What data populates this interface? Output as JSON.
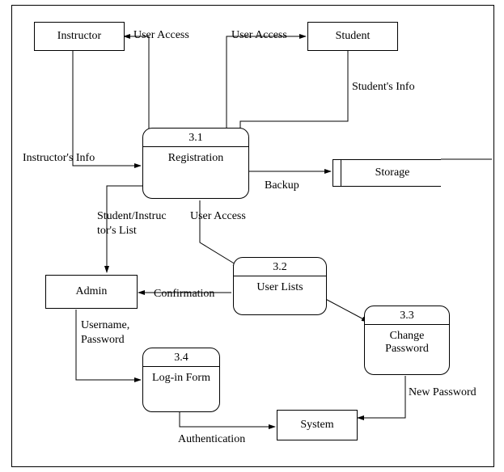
{
  "entities": {
    "instructor": "Instructor",
    "student": "Student",
    "admin": "Admin",
    "system": "System"
  },
  "processes": {
    "p31": {
      "num": "3.1",
      "name": "Registration"
    },
    "p32": {
      "num": "3.2",
      "name": "User Lists"
    },
    "p33": {
      "num": "3.3",
      "name": "Change Password"
    },
    "p34": {
      "num": "3.4",
      "name": "Log-in Form"
    }
  },
  "storage": {
    "label": "Storage"
  },
  "flows": {
    "user_access_1": "User Access",
    "user_access_2": "User Access",
    "user_access_3": "User Access",
    "students_info": "Student's Info",
    "instructors_info": "Instructor's Info",
    "backup": "Backup",
    "student_instructor_list_a": "Student/Instruc",
    "student_instructor_list_b": "tor's List",
    "confirmation": "Confirmation",
    "username_password_a": "Username,",
    "username_password_b": "Password",
    "new_password": "New Password",
    "authentication": "Authentication"
  }
}
